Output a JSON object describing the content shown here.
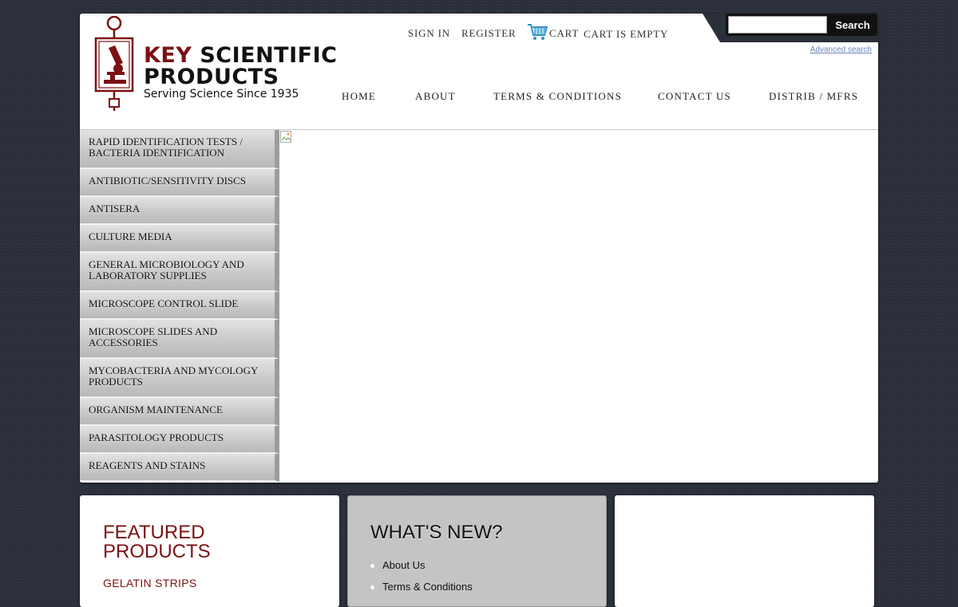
{
  "brand": {
    "name_part1": "KEY",
    "name_part2": " SCIENTIFIC",
    "name_line2": "PRODUCTS",
    "tagline": "Serving Science Since 1935",
    "brand_color": "#7b1114"
  },
  "search": {
    "placeholder": "",
    "value": "",
    "button_label": "Search",
    "advanced_label": "Advanced search"
  },
  "user_links": {
    "sign_in": "SIGN IN",
    "register": "REGISTER",
    "cart_label": "CART",
    "cart_status": "CART IS EMPTY",
    "cart_icon": "shopping-cart-icon"
  },
  "nav": {
    "items": [
      "HOME",
      "ABOUT",
      "TERMS & CONDITIONS",
      "CONTACT US",
      "DISTRIB / MFRS"
    ]
  },
  "sidebar": {
    "items": [
      "RAPID IDENTIFICATION TESTS / BACTERIA IDENTIFICATION",
      "ANTIBIOTIC/SENSITIVITY DISCS",
      "ANTISERA",
      "CULTURE MEDIA",
      "GENERAL MICROBIOLOGY AND LABORATORY SUPPLIES",
      "MICROSCOPE CONTROL SLIDE",
      "MICROSCOPE SLIDES AND ACCESSORIES",
      "MYCOBACTERIA AND MYCOLOGY PRODUCTS",
      "ORGANISM MAINTENANCE",
      "PARASITOLOGY PRODUCTS",
      "REAGENTS AND STAINS"
    ]
  },
  "featured": {
    "title": "FEATURED PRODUCTS",
    "items": [
      "GELATIN STRIPS"
    ]
  },
  "whats_new": {
    "title": "WHAT'S NEW?",
    "items": [
      "About Us",
      "Terms & Conditions"
    ]
  }
}
